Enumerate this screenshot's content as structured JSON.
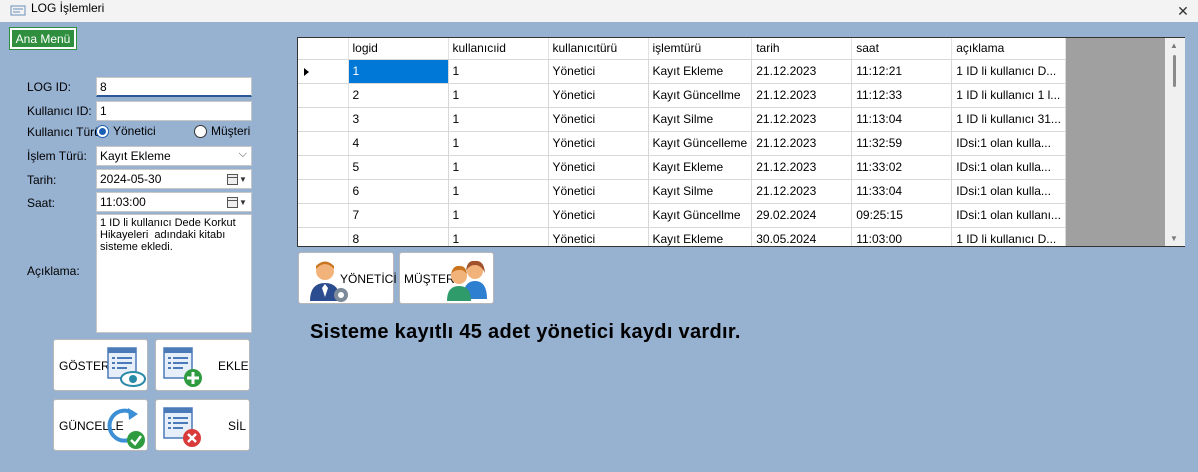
{
  "window": {
    "title": "LOG İşlemleri",
    "close": "✕"
  },
  "menu": {
    "main_menu_label": "Ana Menü"
  },
  "form": {
    "log_id_label": "LOG ID:",
    "log_id_value": "8",
    "user_id_label": "Kullanıcı ID:",
    "user_id_value": "1",
    "user_type_label": "Kullanıcı Türü:",
    "user_type_options": [
      "Yönetici",
      "Müşteri"
    ],
    "user_type_selected": "Yönetici",
    "operation_label": "İşlem Türü:",
    "operation_value": "Kayıt Ekleme",
    "date_label": "Tarih:",
    "date_value": "2024-05-30",
    "time_label": "Saat:",
    "time_value": "11:03:00",
    "description_label": "Açıklama:",
    "description_value": "1 ID li kullanıcı Dede Korkut\nHikayeleri  adındaki kitabı\nsisteme ekledi."
  },
  "actions": {
    "show_label": "GÖSTER",
    "add_label": "EKLE",
    "update_label": "GÜNCELLE",
    "delete_label": "SİL"
  },
  "filters": {
    "admin_label": "YÖNETİCİ",
    "customer_label": "MÜŞTERİ"
  },
  "grid": {
    "columns": [
      "logid",
      "kullanıcıid",
      "kullanıcıtürü",
      "işlemtürü",
      "tarih",
      "saat",
      "açıklama"
    ],
    "rows": [
      [
        "1",
        "1",
        "Yönetici",
        "Kayıt Ekleme",
        "21.12.2023",
        "11:12:21",
        "1 ID li kullanıcı D..."
      ],
      [
        "2",
        "1",
        "Yönetici",
        "Kayıt Güncellme",
        "21.12.2023",
        "11:12:33",
        "1 ID li kullanıcı 1 l..."
      ],
      [
        "3",
        "1",
        "Yönetici",
        "Kayıt Silme",
        "21.12.2023",
        "11:13:04",
        "1 ID li kullanıcı 31..."
      ],
      [
        "4",
        "1",
        "Yönetici",
        "Kayıt Güncelleme",
        "21.12.2023",
        "11:32:59",
        " IDsi:1 olan kulla..."
      ],
      [
        "5",
        "1",
        "Yönetici",
        "Kayıt Ekleme",
        "21.12.2023",
        "11:33:02",
        " IDsi:1 olan kulla..."
      ],
      [
        "6",
        "1",
        "Yönetici",
        "Kayıt Silme",
        "21.12.2023",
        "11:33:04",
        " IDsi:1 olan kulla..."
      ],
      [
        "7",
        "1",
        "Yönetici",
        "Kayıt Güncellme",
        "29.02.2024",
        "09:25:15",
        "IDsi:1 olan kullanı..."
      ],
      [
        "8",
        "1",
        "Yönetici",
        "Kayıt Ekleme",
        "30.05.2024",
        "11:03:00",
        "1 ID li kullanıcı D..."
      ]
    ],
    "selected_row": 0
  },
  "summary_text": "Sisteme kayıtlı 45 adet yönetici kaydı vardır.",
  "colors": {
    "background": "#97b1d1",
    "menu_button": "#2f8f3f",
    "selection": "#0078d7"
  },
  "icons": [
    "app-icon",
    "close-icon",
    "list-eye-icon",
    "list-plus-icon",
    "refresh-check-icon",
    "list-delete-icon",
    "admin-user-icon",
    "customers-icon"
  ]
}
